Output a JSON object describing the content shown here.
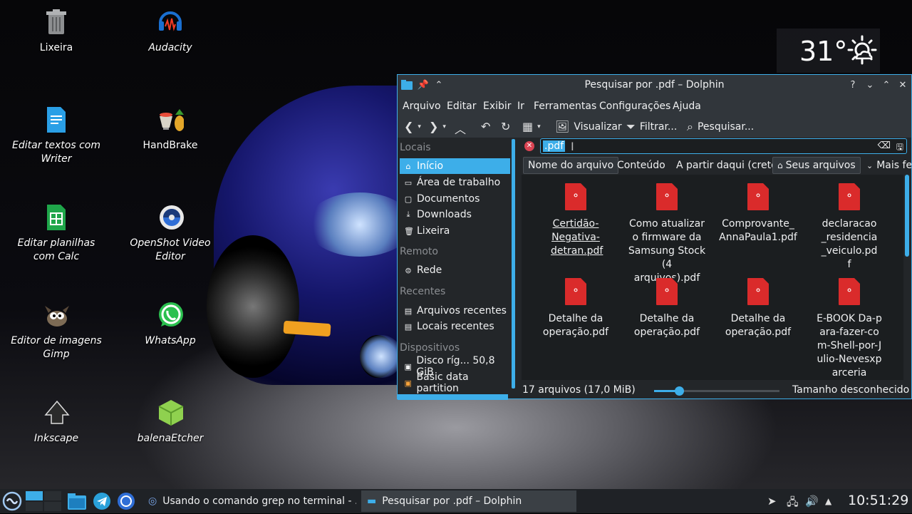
{
  "desktop": {
    "icons": [
      {
        "label": "Lixeira",
        "italic": false
      },
      {
        "label": "Audacity",
        "italic": true
      },
      {
        "label": "Editar textos com Writer",
        "italic": true
      },
      {
        "label": "HandBrake",
        "italic": false
      },
      {
        "label": "Editar planilhas com Calc",
        "italic": true
      },
      {
        "label": "OpenShot Video Editor",
        "italic": true
      },
      {
        "label": "Editor de imagens Gimp",
        "italic": true
      },
      {
        "label": "WhatsApp",
        "italic": true
      },
      {
        "label": "Inkscape",
        "italic": true
      },
      {
        "label": "balenaEtcher",
        "italic": true
      }
    ]
  },
  "weather": {
    "temperature": "31°",
    "icon": "partly-cloudy-sun-icon"
  },
  "window": {
    "title": "Pesquisar por .pdf – Dolphin",
    "menu": [
      "Arquivo",
      "Editar",
      "Exibir",
      "Ir",
      "Ferramentas",
      "Configurações",
      "Ajuda"
    ],
    "toolbar": {
      "preview": "Visualizar",
      "filter": "Filtrar...",
      "search": "Pesquisar..."
    },
    "sidebar": {
      "sections": {
        "places": "Locais",
        "remote": "Remoto",
        "recent": "Recentes",
        "devices": "Dispositivos"
      },
      "places": [
        "Início",
        "Área de trabalho",
        "Documentos",
        "Downloads",
        "Lixeira"
      ],
      "remote": [
        "Rede"
      ],
      "recent": [
        "Arquivos recentes",
        "Locais recentes"
      ],
      "devices": [
        "Disco ríg... 50,8 GiB",
        "Basic data partition"
      ]
    },
    "search": {
      "value": ".pdf"
    },
    "filters": [
      "Nome do arquivo",
      "Conteúdo",
      "A partir daqui (creto)",
      "Seus arquivos",
      "Mais fe"
    ],
    "files": [
      "Certidão-Negativa-detran.pdf",
      "Como atualizar o firmware da Samsung Stock (4 arquivos).pdf",
      "Comprovante_AnnaPaula1.pdf",
      "declaracao_residencia_veiculo.pdf",
      "Detalhe da operação.pdf",
      "Detalhe da operação.pdf",
      "Detalhe da operação.pdf",
      "E-BOOK Da-para-fazer-com-Shell-por-Julio-Nevesxparceria"
    ],
    "status": {
      "count": "17 arquivos (17,0 MiB)",
      "size": "Tamanho desconhecido",
      "zoom_fraction": 0.2
    }
  },
  "taskbar": {
    "tasks": [
      "Usando o comando grep no terminal - ...",
      "Pesquisar por .pdf – Dolphin"
    ],
    "clock": "10:51:29"
  },
  "colors": {
    "accent": "#3daee9",
    "pdf": "#da2b2b",
    "window_bg": "#232629"
  }
}
